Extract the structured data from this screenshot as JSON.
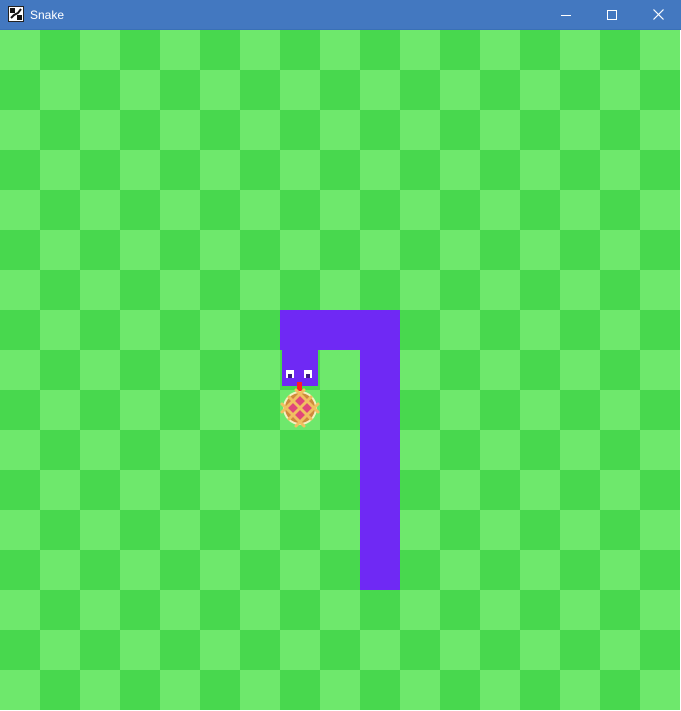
{
  "window": {
    "title": "Snake",
    "icon": "snake-app-icon",
    "controls": [
      "minimize-icon",
      "maximize-icon",
      "close-icon"
    ],
    "titlebar_color": "#4378c0",
    "title_text_color": "#ffffff"
  },
  "game": {
    "grid_columns": 17,
    "grid_rows": 17,
    "colors": {
      "tile_light": "#6ee86c",
      "tile_dark": "#48d84e",
      "snake": "#6f29f4",
      "eye_white": "#ffffff",
      "pupil": "#3a1a80",
      "tongue": "#ff2020",
      "pie_crust": "#d08a3a",
      "pie_filling": "#e0467a"
    },
    "snake": {
      "direction": "down",
      "head": [
        7,
        8
      ],
      "body": [
        [
          7,
          7
        ],
        [
          8,
          7
        ],
        [
          9,
          7
        ],
        [
          9,
          8
        ],
        [
          9,
          9
        ],
        [
          9,
          10
        ],
        [
          9,
          11
        ],
        [
          9,
          12
        ],
        [
          9,
          13
        ]
      ]
    },
    "food": {
      "type": "pie",
      "cell": [
        7,
        9
      ]
    }
  }
}
